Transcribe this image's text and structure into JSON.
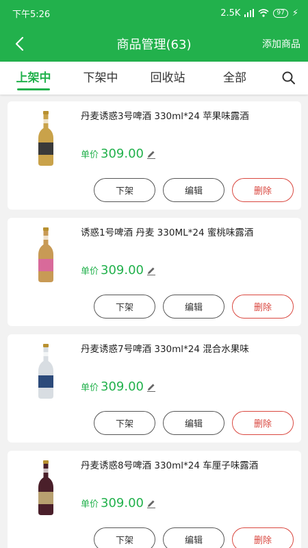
{
  "status_bar": {
    "time": "下午5:26",
    "network_speed": "2.5K",
    "battery": "97"
  },
  "header": {
    "title": "商品管理(63)",
    "add_label": "添加商品"
  },
  "tabs": [
    {
      "label": "上架中",
      "active": true
    },
    {
      "label": "下架中",
      "active": false
    },
    {
      "label": "回收站",
      "active": false
    },
    {
      "label": "全部",
      "active": false
    }
  ],
  "products": [
    {
      "name": "丹麦诱惑3号啤酒 330ml*24 苹果味露酒",
      "price_label": "单价",
      "price": "309.00",
      "bottle_color": "#c9a24a",
      "label_color": "#3a3a3a",
      "actions": {
        "off_shelf": "下架",
        "edit": "编辑",
        "delete": "删除"
      }
    },
    {
      "name": "诱惑1号啤酒 丹麦 330ML*24 蜜桃味露酒",
      "price_label": "单价",
      "price": "309.00",
      "bottle_color": "#c89a55",
      "label_color": "#d86a9a",
      "actions": {
        "off_shelf": "下架",
        "edit": "编辑",
        "delete": "删除"
      }
    },
    {
      "name": "丹麦诱惑7号啤酒 330ml*24 混合水果味",
      "price_label": "单价",
      "price": "309.00",
      "bottle_color": "#d8dde2",
      "label_color": "#2c4a7a",
      "actions": {
        "off_shelf": "下架",
        "edit": "编辑",
        "delete": "删除"
      }
    },
    {
      "name": "丹麦诱惑8号啤酒 330ml*24 车厘子味露酒",
      "price_label": "单价",
      "price": "309.00",
      "bottle_color": "#4a1f2a",
      "label_color": "#b8a070",
      "actions": {
        "off_shelf": "下架",
        "edit": "编辑",
        "delete": "删除"
      }
    }
  ],
  "colors": {
    "brand": "#22b14c",
    "danger": "#d9463e"
  },
  "icons": {
    "back": "chevron-left-icon",
    "search": "search-icon",
    "edit_price": "pencil-icon"
  }
}
